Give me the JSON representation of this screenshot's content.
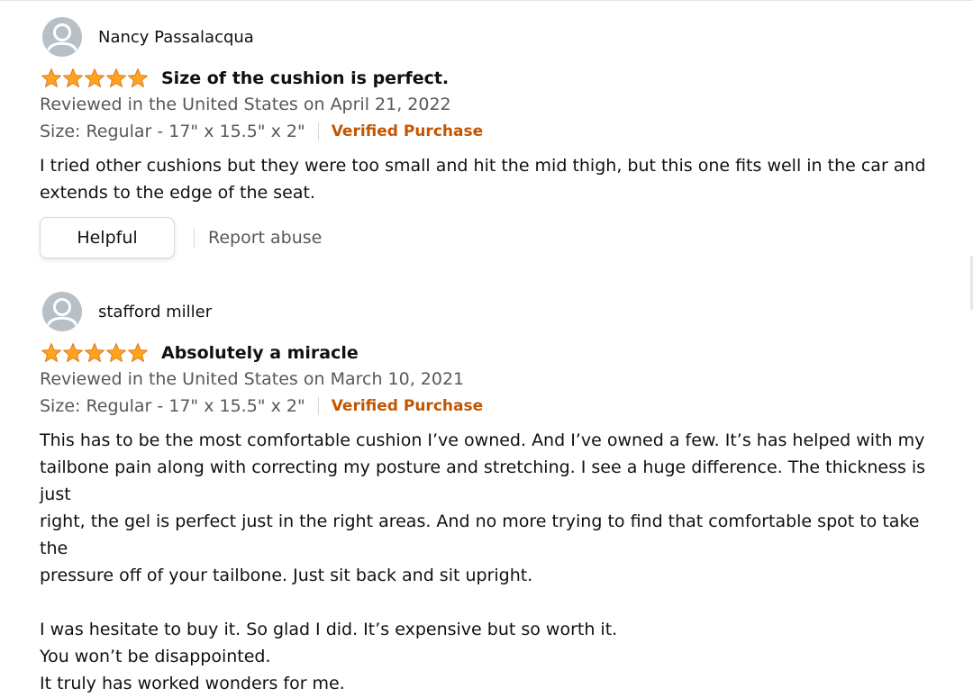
{
  "reviews": [
    {
      "reviewer": "Nancy Passalacqua",
      "rating": 5,
      "title": "Size of the cushion is perfect.",
      "reviewed_line": "Reviewed in the United States on April 21, 2022",
      "size": "Size: Regular - 17\" x 15.5\" x 2\"",
      "verified": "Verified Purchase",
      "body": [
        "I tried other cushions but they were too small and hit the mid thigh, but this one fits well in the car and",
        "extends to the edge of the seat."
      ],
      "helpful_label": "Helpful",
      "report_label": "Report abuse"
    },
    {
      "reviewer": "stafford miller",
      "rating": 5,
      "title": "Absolutely a miracle",
      "reviewed_line": "Reviewed in the United States on March 10, 2021",
      "size": "Size: Regular - 17\" x 15.5\" x 2\"",
      "verified": "Verified Purchase",
      "body": [
        "This has to be the most comfortable cushion I’ve owned. And I’ve owned a few. It’s has helped with my",
        "tailbone pain along with correcting my posture and stretching. I see a huge difference. The thickness is just",
        "right, the gel is perfect just in the right areas. And no more trying to find that comfortable spot to take the",
        "pressure off of your tailbone. Just sit back and sit upright.",
        "",
        "I was hesitate to buy it. So glad I did. It’s expensive but so worth it.",
        "You won’t be disappointed.",
        "It truly has worked wonders for me."
      ]
    }
  ],
  "colors": {
    "star": "#ffa41c",
    "verified": "#c45500",
    "muted": "#565959"
  },
  "icons": {
    "avatar": "default-user-avatar-icon",
    "star": "star-icon"
  }
}
